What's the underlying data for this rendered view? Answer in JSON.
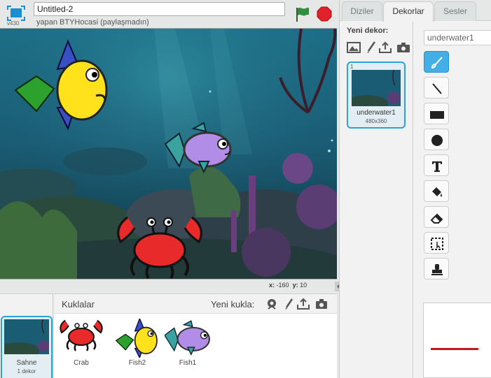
{
  "app": {
    "version": "v430",
    "project_title": "Untitled-2",
    "author_line": "yapan BTYHocasi (paylaşmadın)"
  },
  "stage": {
    "x_label": "x:",
    "x_value": "-160",
    "y_label": "y:",
    "y_value": "10"
  },
  "stage_thumb": {
    "label": "Sahne",
    "sub": "1 dekor"
  },
  "sprites": {
    "title": "Kuklalar",
    "new_label": "Yeni kukla:",
    "items": [
      {
        "name": "Crab"
      },
      {
        "name": "Fish2"
      },
      {
        "name": "Fish1"
      }
    ]
  },
  "tabs": [
    {
      "label": "Diziler"
    },
    {
      "label": "Dekorlar"
    },
    {
      "label": "Sesler"
    }
  ],
  "costumes": {
    "new_label": "Yeni dekor:",
    "item": {
      "number": "1",
      "name": "underwater1",
      "size": "480x360"
    }
  },
  "editor": {
    "costume_name": "underwater1",
    "tools": [
      "brush-icon",
      "line-icon",
      "rectangle-icon",
      "ellipse-icon",
      "text-icon",
      "fill-icon",
      "eraser-icon",
      "select-icon",
      "stamp-icon"
    ]
  },
  "colors": {
    "accent": "#2aa4d8",
    "active_tool": "#42b0e6",
    "stop_red": "#e0212a",
    "flag_green": "#2f8f3f",
    "stroke_preview": "#c8161d"
  }
}
